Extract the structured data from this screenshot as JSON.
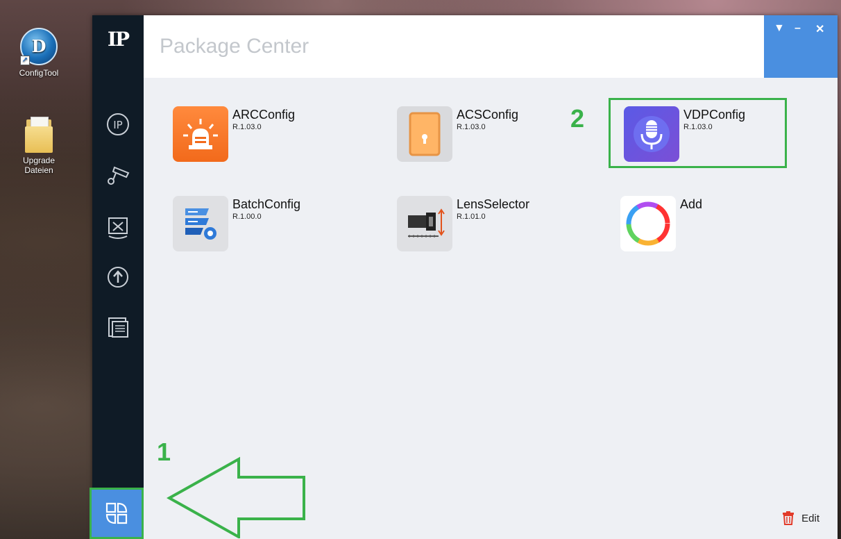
{
  "desktop": {
    "icons": [
      {
        "label": "ConfigTool",
        "icon": "configtool-app-icon"
      },
      {
        "label": "Upgrade Dateien",
        "icon": "folder-icon"
      }
    ]
  },
  "window": {
    "title": "Package Center",
    "controls": {
      "menu": "▼",
      "minimize": "–",
      "close": "✕"
    }
  },
  "sidebar": {
    "logo": "IP",
    "items": [
      {
        "name": "ip-config-icon"
      },
      {
        "name": "camera-icon"
      },
      {
        "name": "tools-icon"
      },
      {
        "name": "upgrade-icon"
      },
      {
        "name": "document-icon"
      },
      {
        "name": "package-center-icon",
        "active": true
      }
    ]
  },
  "apps": [
    {
      "name": "ARCConfig",
      "version": "R.1.03.0"
    },
    {
      "name": "ACSConfig",
      "version": "R.1.03.0"
    },
    {
      "name": "VDPConfig",
      "version": "R.1.03.0"
    },
    {
      "name": "BatchConfig",
      "version": "R.1.00.0"
    },
    {
      "name": "LensSelector",
      "version": "R.1.01.0"
    },
    {
      "name": "Add",
      "version": ""
    }
  ],
  "annotations": {
    "step1": "1",
    "step2": "2"
  },
  "footer": {
    "edit_label": "Edit"
  },
  "colors": {
    "accent": "#4a8fe0",
    "sidebar": "#0f1b26",
    "annotation": "#3ab24a"
  }
}
